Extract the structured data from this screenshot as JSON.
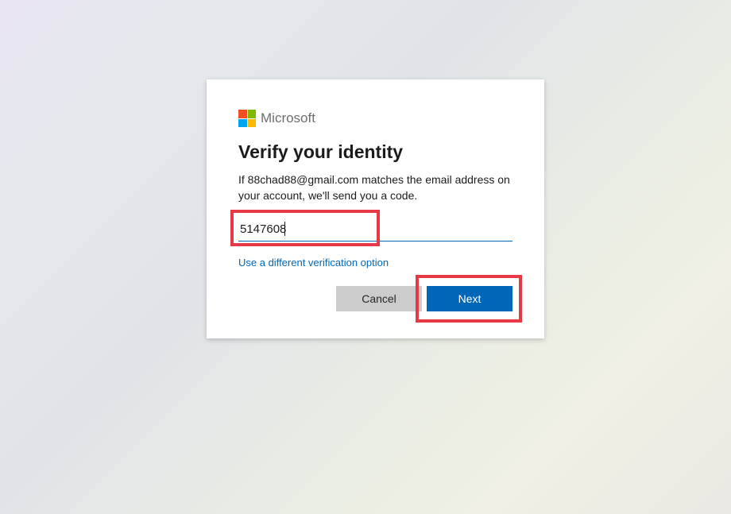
{
  "brand": {
    "name": "Microsoft"
  },
  "heading": "Verify your identity",
  "description": "If 88chad88@gmail.com matches the email address on your account, we'll send you a code.",
  "input": {
    "value": "5147608"
  },
  "link": {
    "label": "Use a different verification option"
  },
  "buttons": {
    "cancel": "Cancel",
    "next": "Next"
  }
}
